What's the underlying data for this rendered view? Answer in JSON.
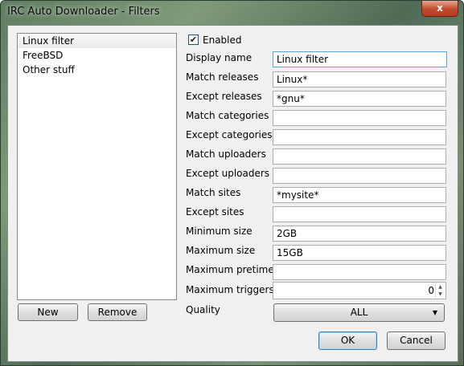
{
  "window": {
    "title": "IRC Auto Downloader - Filters",
    "close_glyph": "x"
  },
  "filters": [
    "Linux filter",
    "FreeBSD",
    "Other stuff"
  ],
  "buttons": {
    "new": "New",
    "remove": "Remove",
    "ok": "OK",
    "cancel": "Cancel"
  },
  "enabled": {
    "label": "Enabled",
    "checked": true,
    "check_glyph": "✔"
  },
  "fields": {
    "display_name": {
      "label": "Display name",
      "value": "Linux filter"
    },
    "match_releases": {
      "label": "Match releases",
      "value": "Linux*"
    },
    "except_releases": {
      "label": "Except releases",
      "value": "*gnu*"
    },
    "match_categories": {
      "label": "Match categories",
      "value": ""
    },
    "except_categories": {
      "label": "Except categories",
      "value": ""
    },
    "match_uploaders": {
      "label": "Match uploaders",
      "value": ""
    },
    "except_uploaders": {
      "label": "Except uploaders",
      "value": ""
    },
    "match_sites": {
      "label": "Match sites",
      "value": "*mysite*"
    },
    "except_sites": {
      "label": "Except sites",
      "value": ""
    },
    "minimum_size": {
      "label": "Minimum size",
      "value": "2GB"
    },
    "maximum_size": {
      "label": "Maximum size",
      "value": "15GB"
    },
    "maximum_pretime": {
      "label": "Maximum pretime",
      "value": ""
    },
    "maximum_triggers": {
      "label": "Maximum triggers",
      "value": "0"
    },
    "quality": {
      "label": "Quality",
      "value": "ALL"
    }
  },
  "icons": {
    "close": "close-icon",
    "dropdown": "chevron-down-icon",
    "spin_up": "spin-up-icon",
    "spin_down": "spin-down-icon"
  }
}
